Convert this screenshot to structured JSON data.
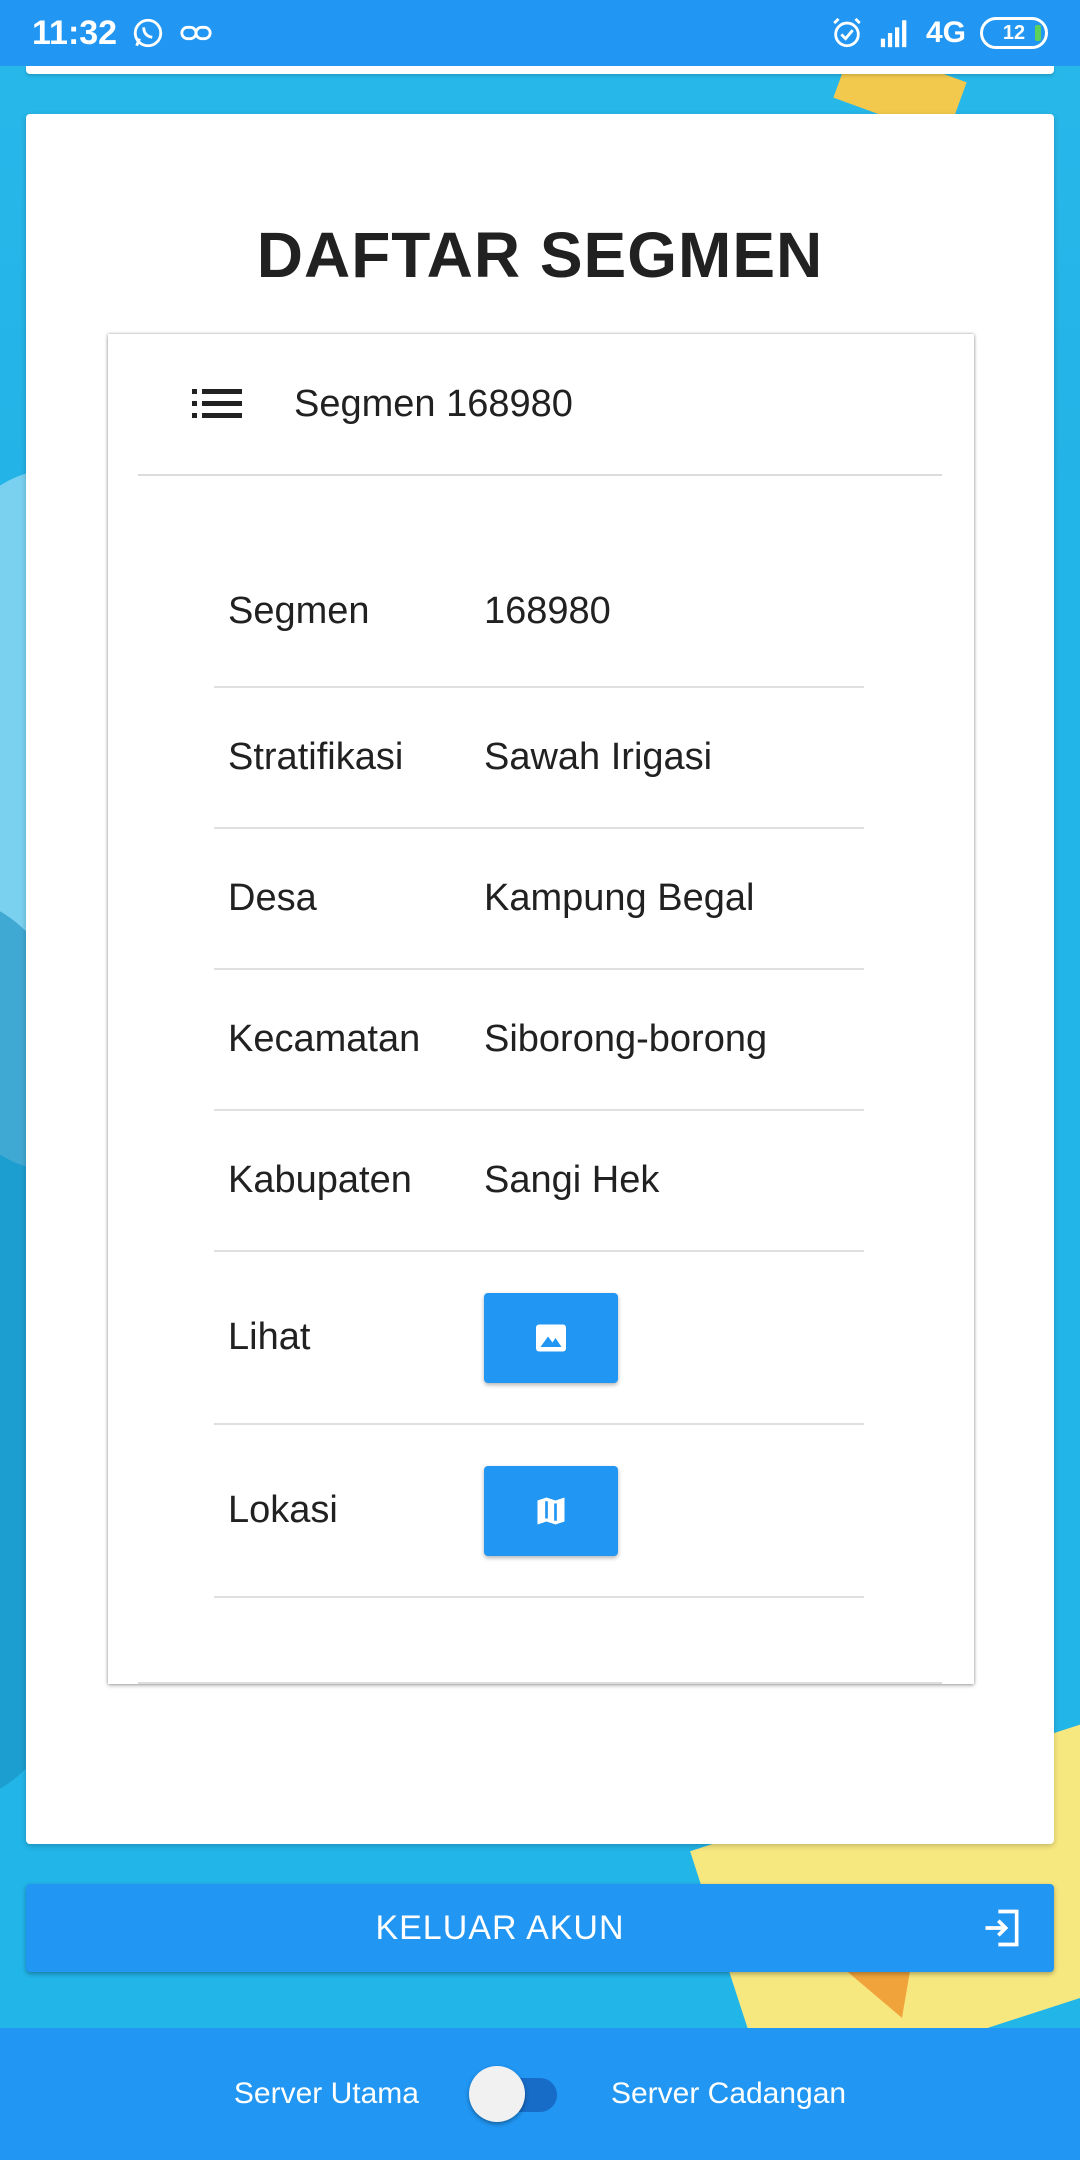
{
  "status_bar": {
    "time": "11:32",
    "network": "4G",
    "battery": "12",
    "icons": [
      "whatsapp-icon",
      "link-icon",
      "alarm-icon",
      "signal-icon",
      "battery-icon"
    ]
  },
  "page": {
    "title": "DAFTAR SEGMEN"
  },
  "segment_card": {
    "header_icon": "list-icon",
    "header_title": "Segmen 168980",
    "rows": [
      {
        "label": "Segmen",
        "value": "168980"
      },
      {
        "label": "Stratifikasi",
        "value": "Sawah Irigasi"
      },
      {
        "label": "Desa",
        "value": "Kampung Begal"
      },
      {
        "label": "Kecamatan",
        "value": "Siborong-borong"
      },
      {
        "label": "Kabupaten",
        "value": "Sangi Hek"
      }
    ],
    "actions": [
      {
        "label": "Lihat",
        "icon": "image-icon"
      },
      {
        "label": "Lokasi",
        "icon": "map-icon"
      }
    ]
  },
  "logout": {
    "label": "KELUAR AKUN",
    "icon": "logout-icon"
  },
  "server_switch": {
    "left_label": "Server Utama",
    "right_label": "Server Cadangan",
    "is_backup_selected": false
  },
  "colors": {
    "primary": "#2196f3",
    "background": "#22b5e8",
    "card": "#ffffff",
    "text": "#212121"
  }
}
